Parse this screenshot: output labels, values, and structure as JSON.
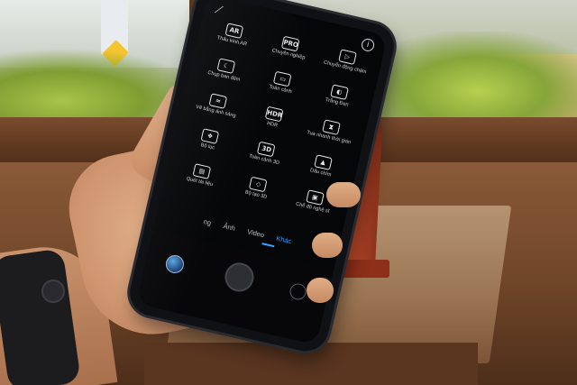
{
  "photo": {
    "description_tags": [
      "hand",
      "smartphone",
      "camera-app",
      "fitness-band",
      "wooden-table"
    ]
  },
  "camera_app": {
    "top": {
      "back_icon": "back-icon",
      "info_icon": "info-icon",
      "info_glyph": "i"
    },
    "modes": [
      {
        "label": "Thấu kính AR",
        "icon": "ar-lens-icon",
        "glyph": "AR"
      },
      {
        "label": "Chuyên nghiệp",
        "icon": "pro-icon",
        "glyph": "PRO"
      },
      {
        "label": "Chuyển động chậm",
        "icon": "slow-motion-icon",
        "glyph": "▷"
      },
      {
        "label": "Chụp ban đêm",
        "icon": "night-icon",
        "glyph": "☾"
      },
      {
        "label": "Toàn cảnh",
        "icon": "panorama-icon",
        "glyph": "▭"
      },
      {
        "label": "Trắng Đen",
        "icon": "mono-icon",
        "glyph": "◐"
      },
      {
        "label": "Vẽ bằng ánh sáng",
        "icon": "light-painting-icon",
        "glyph": "≈"
      },
      {
        "label": "HDR",
        "icon": "hdr-icon",
        "glyph": "HDR"
      },
      {
        "label": "Tua nhanh thời gian",
        "icon": "timelapse-icon",
        "glyph": "⧗"
      },
      {
        "label": "Bộ lọc",
        "icon": "filter-icon",
        "glyph": "❖"
      },
      {
        "label": "Toàn cảnh 3D",
        "icon": "3d-panorama-icon",
        "glyph": "3D"
      },
      {
        "label": "Dấu chìm",
        "icon": "watermark-icon",
        "glyph": "▲"
      },
      {
        "label": "Quét tài liệu",
        "icon": "document-scan-icon",
        "glyph": "▤"
      },
      {
        "label": "Bộ tạo 3D",
        "icon": "3d-creator-icon",
        "glyph": "◇"
      },
      {
        "label": "Chế độ nghệ sĩ",
        "icon": "artist-icon",
        "glyph": "▣"
      }
    ],
    "tabs": [
      {
        "label": "ng",
        "active": false
      },
      {
        "label": "Ảnh",
        "active": false
      },
      {
        "label": "Video",
        "active": false
      },
      {
        "label": "Khác",
        "active": true
      }
    ],
    "bottom": {
      "gallery_icon": "gallery-thumbnail-icon",
      "shutter_icon": "shutter-button-icon",
      "switch_camera_icon": "switch-camera-icon"
    },
    "accent_color": "#3aa0ff"
  }
}
